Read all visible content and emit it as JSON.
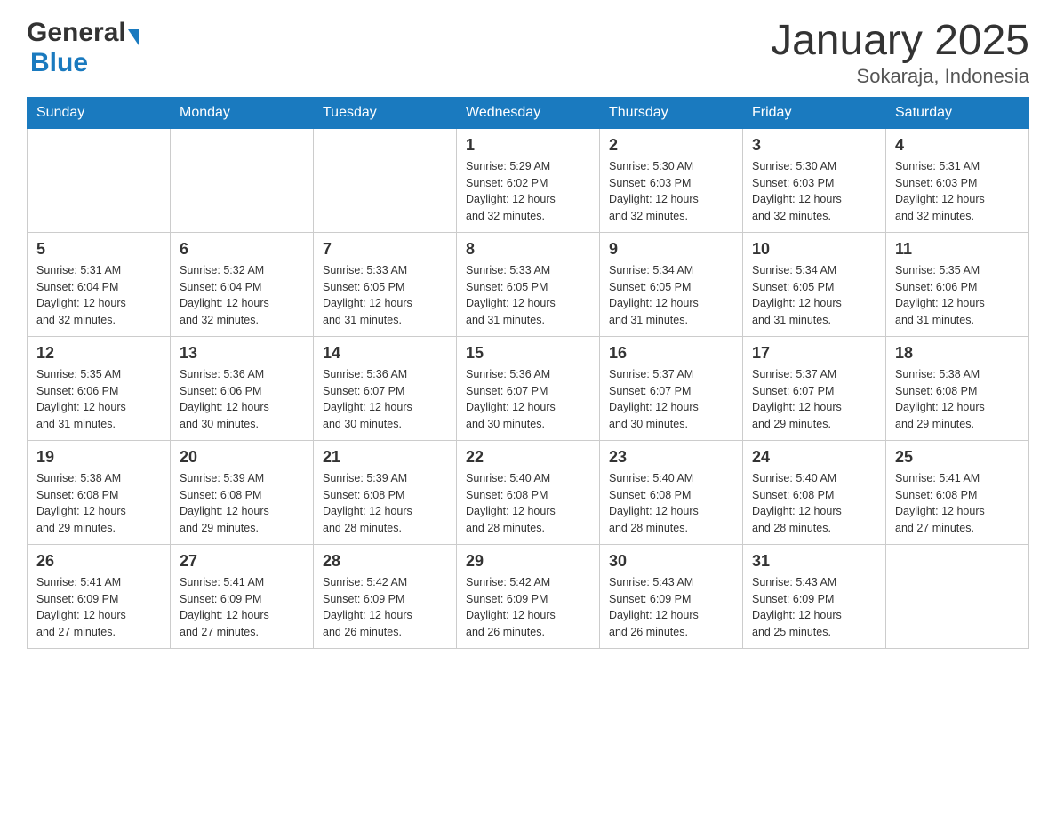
{
  "logo": {
    "general": "General",
    "blue": "Blue"
  },
  "title": "January 2025",
  "subtitle": "Sokaraja, Indonesia",
  "days": [
    "Sunday",
    "Monday",
    "Tuesday",
    "Wednesday",
    "Thursday",
    "Friday",
    "Saturday"
  ],
  "weeks": [
    [
      {
        "day": "",
        "info": ""
      },
      {
        "day": "",
        "info": ""
      },
      {
        "day": "",
        "info": ""
      },
      {
        "day": "1",
        "info": "Sunrise: 5:29 AM\nSunset: 6:02 PM\nDaylight: 12 hours\nand 32 minutes."
      },
      {
        "day": "2",
        "info": "Sunrise: 5:30 AM\nSunset: 6:03 PM\nDaylight: 12 hours\nand 32 minutes."
      },
      {
        "day": "3",
        "info": "Sunrise: 5:30 AM\nSunset: 6:03 PM\nDaylight: 12 hours\nand 32 minutes."
      },
      {
        "day": "4",
        "info": "Sunrise: 5:31 AM\nSunset: 6:03 PM\nDaylight: 12 hours\nand 32 minutes."
      }
    ],
    [
      {
        "day": "5",
        "info": "Sunrise: 5:31 AM\nSunset: 6:04 PM\nDaylight: 12 hours\nand 32 minutes."
      },
      {
        "day": "6",
        "info": "Sunrise: 5:32 AM\nSunset: 6:04 PM\nDaylight: 12 hours\nand 32 minutes."
      },
      {
        "day": "7",
        "info": "Sunrise: 5:33 AM\nSunset: 6:05 PM\nDaylight: 12 hours\nand 31 minutes."
      },
      {
        "day": "8",
        "info": "Sunrise: 5:33 AM\nSunset: 6:05 PM\nDaylight: 12 hours\nand 31 minutes."
      },
      {
        "day": "9",
        "info": "Sunrise: 5:34 AM\nSunset: 6:05 PM\nDaylight: 12 hours\nand 31 minutes."
      },
      {
        "day": "10",
        "info": "Sunrise: 5:34 AM\nSunset: 6:05 PM\nDaylight: 12 hours\nand 31 minutes."
      },
      {
        "day": "11",
        "info": "Sunrise: 5:35 AM\nSunset: 6:06 PM\nDaylight: 12 hours\nand 31 minutes."
      }
    ],
    [
      {
        "day": "12",
        "info": "Sunrise: 5:35 AM\nSunset: 6:06 PM\nDaylight: 12 hours\nand 31 minutes."
      },
      {
        "day": "13",
        "info": "Sunrise: 5:36 AM\nSunset: 6:06 PM\nDaylight: 12 hours\nand 30 minutes."
      },
      {
        "day": "14",
        "info": "Sunrise: 5:36 AM\nSunset: 6:07 PM\nDaylight: 12 hours\nand 30 minutes."
      },
      {
        "day": "15",
        "info": "Sunrise: 5:36 AM\nSunset: 6:07 PM\nDaylight: 12 hours\nand 30 minutes."
      },
      {
        "day": "16",
        "info": "Sunrise: 5:37 AM\nSunset: 6:07 PM\nDaylight: 12 hours\nand 30 minutes."
      },
      {
        "day": "17",
        "info": "Sunrise: 5:37 AM\nSunset: 6:07 PM\nDaylight: 12 hours\nand 29 minutes."
      },
      {
        "day": "18",
        "info": "Sunrise: 5:38 AM\nSunset: 6:08 PM\nDaylight: 12 hours\nand 29 minutes."
      }
    ],
    [
      {
        "day": "19",
        "info": "Sunrise: 5:38 AM\nSunset: 6:08 PM\nDaylight: 12 hours\nand 29 minutes."
      },
      {
        "day": "20",
        "info": "Sunrise: 5:39 AM\nSunset: 6:08 PM\nDaylight: 12 hours\nand 29 minutes."
      },
      {
        "day": "21",
        "info": "Sunrise: 5:39 AM\nSunset: 6:08 PM\nDaylight: 12 hours\nand 28 minutes."
      },
      {
        "day": "22",
        "info": "Sunrise: 5:40 AM\nSunset: 6:08 PM\nDaylight: 12 hours\nand 28 minutes."
      },
      {
        "day": "23",
        "info": "Sunrise: 5:40 AM\nSunset: 6:08 PM\nDaylight: 12 hours\nand 28 minutes."
      },
      {
        "day": "24",
        "info": "Sunrise: 5:40 AM\nSunset: 6:08 PM\nDaylight: 12 hours\nand 28 minutes."
      },
      {
        "day": "25",
        "info": "Sunrise: 5:41 AM\nSunset: 6:08 PM\nDaylight: 12 hours\nand 27 minutes."
      }
    ],
    [
      {
        "day": "26",
        "info": "Sunrise: 5:41 AM\nSunset: 6:09 PM\nDaylight: 12 hours\nand 27 minutes."
      },
      {
        "day": "27",
        "info": "Sunrise: 5:41 AM\nSunset: 6:09 PM\nDaylight: 12 hours\nand 27 minutes."
      },
      {
        "day": "28",
        "info": "Sunrise: 5:42 AM\nSunset: 6:09 PM\nDaylight: 12 hours\nand 26 minutes."
      },
      {
        "day": "29",
        "info": "Sunrise: 5:42 AM\nSunset: 6:09 PM\nDaylight: 12 hours\nand 26 minutes."
      },
      {
        "day": "30",
        "info": "Sunrise: 5:43 AM\nSunset: 6:09 PM\nDaylight: 12 hours\nand 26 minutes."
      },
      {
        "day": "31",
        "info": "Sunrise: 5:43 AM\nSunset: 6:09 PM\nDaylight: 12 hours\nand 25 minutes."
      },
      {
        "day": "",
        "info": ""
      }
    ]
  ]
}
